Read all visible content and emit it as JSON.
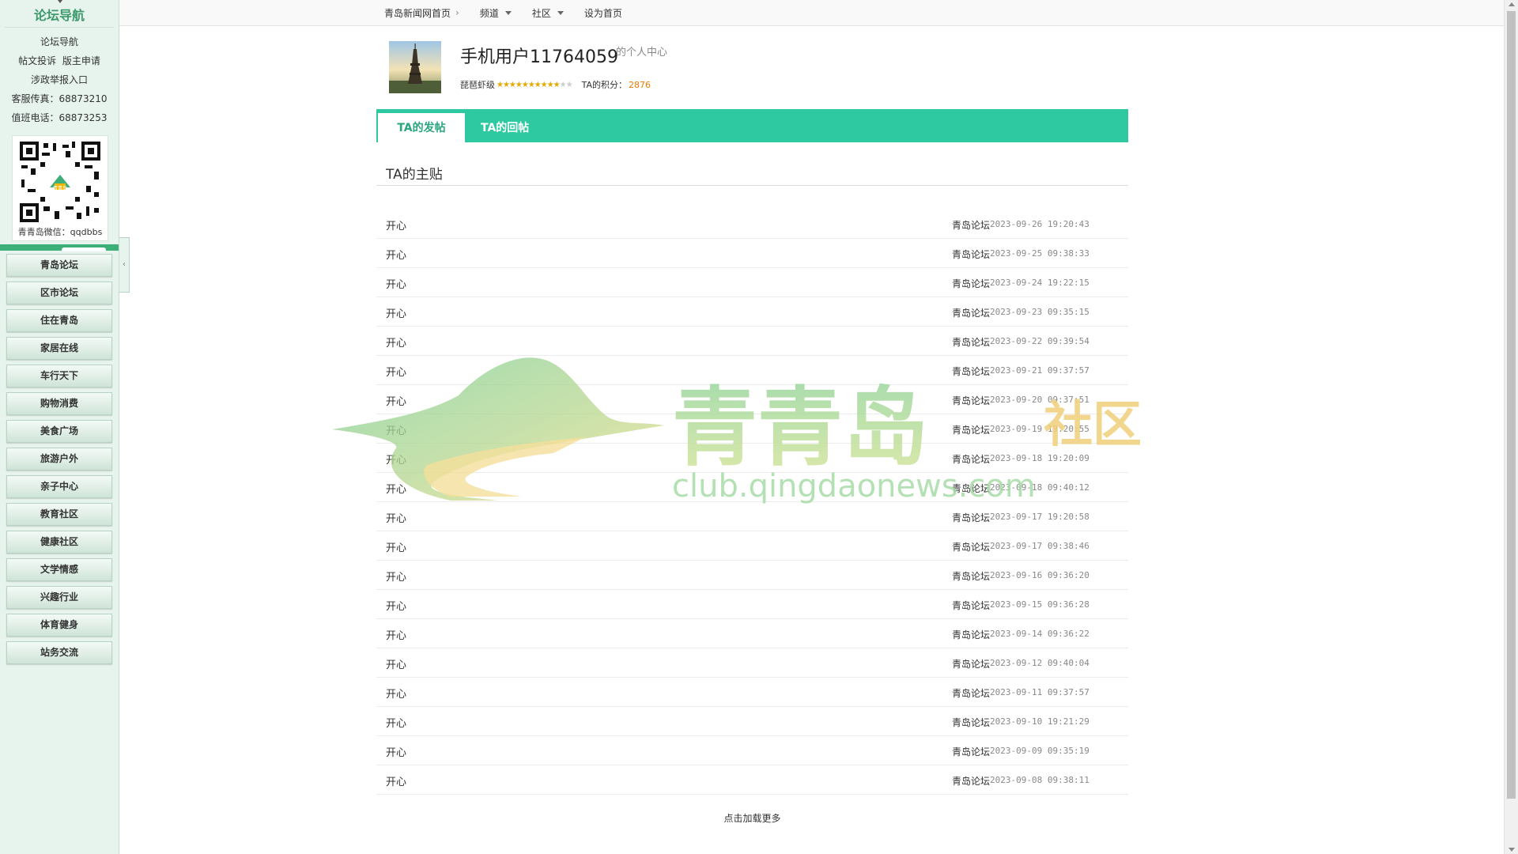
{
  "sidebar": {
    "title": "论坛导航",
    "links": [
      "论坛导航",
      "帖文投诉",
      "版主申请",
      "涉政举报入口"
    ],
    "contacts": [
      "客服传真：68873210",
      "值班电话：68873253"
    ],
    "wechat": "青青岛微信：qqdbbs",
    "qr_badge": "青青岛",
    "nav": [
      "青岛论坛",
      "区市论坛",
      "住在青岛",
      "家居在线",
      "车行天下",
      "购物消费",
      "美食广场",
      "旅游户外",
      "亲子中心",
      "教育社区",
      "健康社区",
      "文学情感",
      "兴趣行业",
      "体育健身",
      "站务交流"
    ],
    "collapse_glyph": "‹"
  },
  "topnav": {
    "home": "青岛新闻网首页",
    "channel": "频道",
    "community": "社区",
    "set_home": "设为首页"
  },
  "profile": {
    "username": "手机用户11764059",
    "subtitle": "的个人中心",
    "level": "琵琶虾级",
    "stars_on": "★★★★★★★★★★",
    "stars_off": "★★",
    "score_label": "TA的积分：",
    "score": "2876"
  },
  "tabs": {
    "posts": "TA的发帖",
    "replies": "TA的回帖"
  },
  "section_title": "TA的主贴",
  "posts": [
    {
      "title": "开心",
      "source": "青岛论坛",
      "date": "2023-09-26 19:20:43"
    },
    {
      "title": "开心",
      "source": "青岛论坛",
      "date": "2023-09-25 09:38:33"
    },
    {
      "title": "开心",
      "source": "青岛论坛",
      "date": "2023-09-24 19:22:15"
    },
    {
      "title": "开心",
      "source": "青岛论坛",
      "date": "2023-09-23 09:35:15"
    },
    {
      "title": "开心",
      "source": "青岛论坛",
      "date": "2023-09-22 09:39:54"
    },
    {
      "title": "开心",
      "source": "青岛论坛",
      "date": "2023-09-21 09:37:57"
    },
    {
      "title": "开心",
      "source": "青岛论坛",
      "date": "2023-09-20 09:37:51"
    },
    {
      "title": "开心",
      "source": "青岛论坛",
      "date": "2023-09-19 19:20:55"
    },
    {
      "title": "开心",
      "source": "青岛论坛",
      "date": "2023-09-18 19:20:09"
    },
    {
      "title": "开心",
      "source": "青岛论坛",
      "date": "2023-09-18 09:40:12"
    },
    {
      "title": "开心",
      "source": "青岛论坛",
      "date": "2023-09-17 19:20:58"
    },
    {
      "title": "开心",
      "source": "青岛论坛",
      "date": "2023-09-17 09:38:46"
    },
    {
      "title": "开心",
      "source": "青岛论坛",
      "date": "2023-09-16 09:36:20"
    },
    {
      "title": "开心",
      "source": "青岛论坛",
      "date": "2023-09-15 09:36:28"
    },
    {
      "title": "开心",
      "source": "青岛论坛",
      "date": "2023-09-14 09:36:22"
    },
    {
      "title": "开心",
      "source": "青岛论坛",
      "date": "2023-09-12 09:40:04"
    },
    {
      "title": "开心",
      "source": "青岛论坛",
      "date": "2023-09-11 09:37:57"
    },
    {
      "title": "开心",
      "source": "青岛论坛",
      "date": "2023-09-10 19:21:29"
    },
    {
      "title": "开心",
      "source": "青岛论坛",
      "date": "2023-09-09 09:35:19"
    },
    {
      "title": "开心",
      "source": "青岛论坛",
      "date": "2023-09-08 09:38:11"
    }
  ],
  "load_more": "点击加载更多",
  "watermark": {
    "main": "青青岛",
    "tag": "社区",
    "url": "club.qingdaonews.com"
  },
  "colors": {
    "tab_bar": "#2ec9a0",
    "accent_green": "#3db07a",
    "score": "#f07800"
  }
}
